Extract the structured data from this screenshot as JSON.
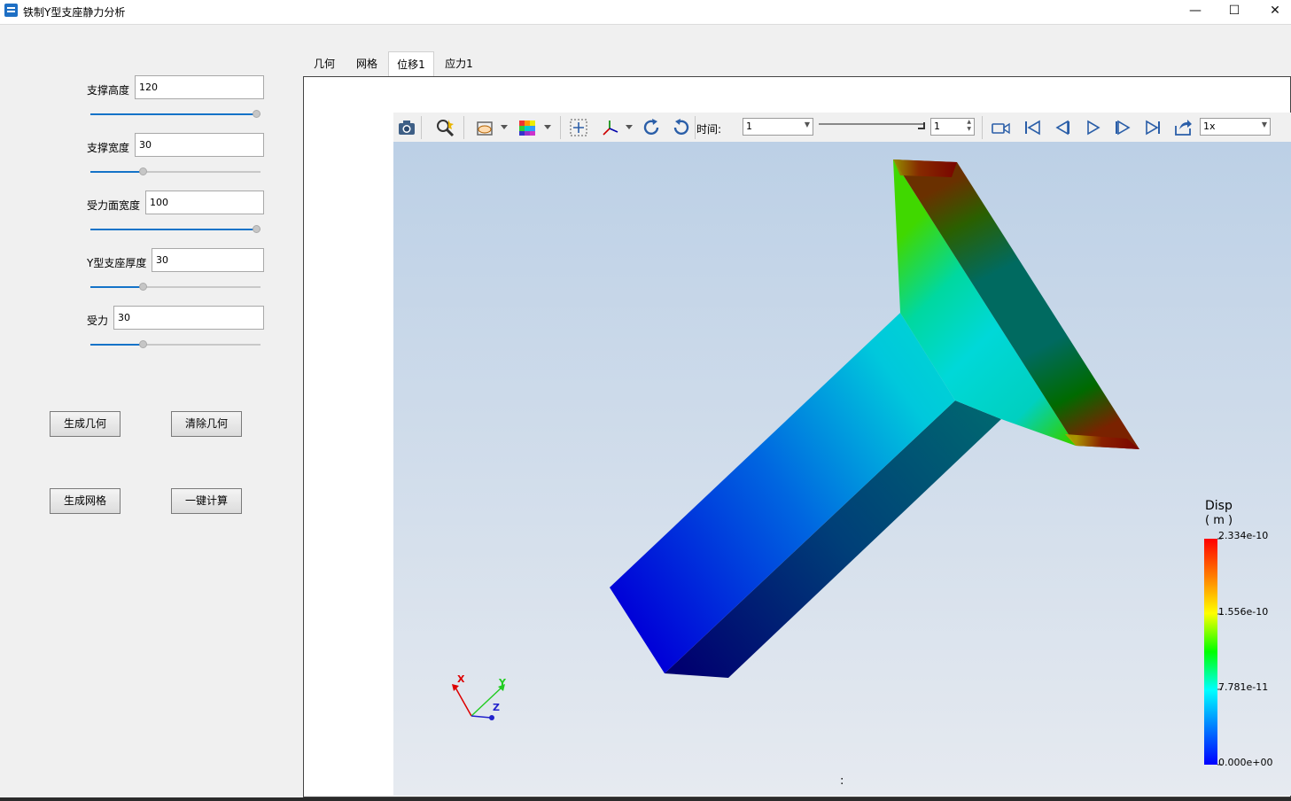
{
  "window": {
    "title": "铁制Y型支座静力分析",
    "minimize": "—",
    "maximize": "☐",
    "close": "✕"
  },
  "params": {
    "height": {
      "label": "支撑高度",
      "value": "120",
      "level": 1.0
    },
    "width": {
      "label": "支撑宽度",
      "value": "30",
      "level": 0.3
    },
    "face_width": {
      "label": "受力面宽度",
      "value": "100",
      "level": 1.0
    },
    "thickness": {
      "label": "Y型支座厚度",
      "value": "30",
      "level": 0.3
    },
    "force": {
      "label": "受力",
      "value": "30",
      "level": 0.3
    }
  },
  "buttons": {
    "gen_geom": "生成几何",
    "clear_geom": "清除几何",
    "gen_mesh": "生成网格",
    "compute": "一键计算"
  },
  "tabs": [
    "几何",
    "网格",
    "位移1",
    "应力1"
  ],
  "active_tab": 2,
  "toolbar": {
    "time_label": "时间:",
    "time_value": "1",
    "frame_value": "1",
    "speed_value": "1x",
    "frame_level": 1.0
  },
  "legend": {
    "title": "Disp",
    "unit": "( m )",
    "max": "2.334e-10",
    "v2": "1.556e-10",
    "v1": "7.781e-11",
    "min": "0.000e+00"
  },
  "axes": {
    "x": "X",
    "y": "Y",
    "z": "Z"
  },
  "status": ":",
  "icons": [
    "camera-icon",
    "zoom-icon",
    "display-mode-icon",
    "colormap-icon",
    "fit-view-icon",
    "axes-icon",
    "rotate-cw-icon",
    "rotate-ccw-icon",
    "record-icon",
    "first-frame-icon",
    "prev-frame-icon",
    "play-icon",
    "next-frame-icon",
    "last-frame-icon",
    "export-icon"
  ]
}
